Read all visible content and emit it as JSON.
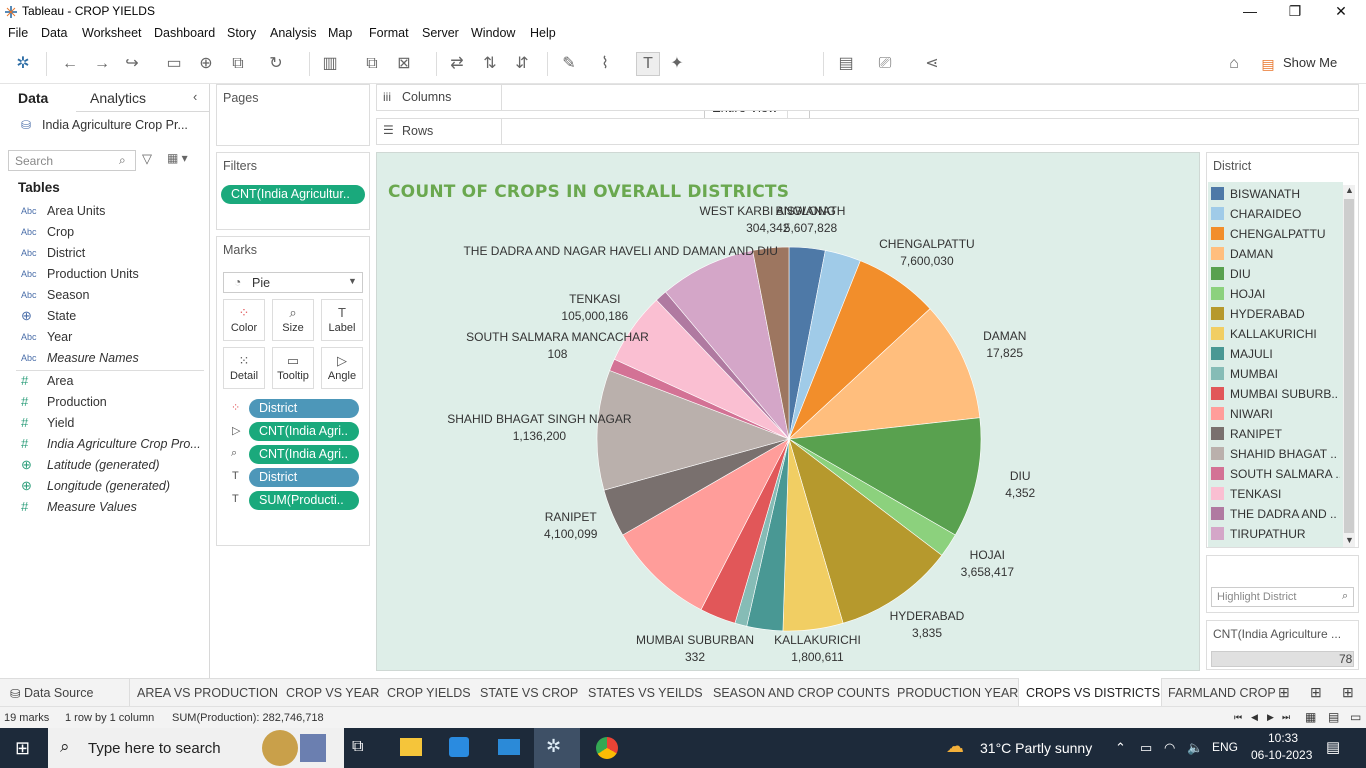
{
  "window": {
    "title": "Tableau - CROP YIELDS",
    "minimize": "—",
    "restore": "❐",
    "close": "✕"
  },
  "menu": [
    "File",
    "Data",
    "Worksheet",
    "Dashboard",
    "Story",
    "Analysis",
    "Map",
    "Format",
    "Server",
    "Window",
    "Help"
  ],
  "toolbar": {
    "fit_mode": "Entire View",
    "show_me": "Show Me"
  },
  "data_pane": {
    "tab_data": "Data",
    "tab_analytics": "Analytics",
    "datasource": "India Agriculture Crop Pr...",
    "search_placeholder": "Search",
    "tables_heading": "Tables",
    "dimensions": [
      {
        "type": "Abc",
        "name": "Area Units"
      },
      {
        "type": "Abc",
        "name": "Crop"
      },
      {
        "type": "Abc",
        "name": "District"
      },
      {
        "type": "Abc",
        "name": "Production Units"
      },
      {
        "type": "Abc",
        "name": "Season"
      },
      {
        "type": "⊕",
        "name": "State"
      },
      {
        "type": "Abc",
        "name": "Year"
      },
      {
        "type": "Abc",
        "name": "Measure Names"
      }
    ],
    "measures": [
      {
        "type": "#",
        "name": "Area"
      },
      {
        "type": "#",
        "name": "Production"
      },
      {
        "type": "#",
        "name": "Yield"
      },
      {
        "type": "#",
        "name": "India Agriculture Crop Pro..."
      },
      {
        "type": "⊕",
        "name": "Latitude (generated)"
      },
      {
        "type": "⊕",
        "name": "Longitude (generated)"
      },
      {
        "type": "#",
        "name": "Measure Values"
      }
    ]
  },
  "pages": {
    "title": "Pages"
  },
  "filters": {
    "title": "Filters",
    "pill": "CNT(India Agricultur.."
  },
  "marks": {
    "title": "Marks",
    "type": "Pie",
    "buttons": [
      "Color",
      "Size",
      "Label",
      "Detail",
      "Tooltip",
      "Angle"
    ],
    "pills": [
      "District",
      "CNT(India Agri..",
      "CNT(India Agri..",
      "District",
      "SUM(Producti.."
    ]
  },
  "shelves": {
    "columns": "Columns",
    "rows": "Rows"
  },
  "chart": {
    "title": "COUNT OF CROPS IN OVERALL DISTRICTS"
  },
  "chart_data": {
    "type": "pie",
    "slices": [
      {
        "name": "BISWANATH",
        "count": 3,
        "production": "5,607,828",
        "color": "#4e79a7"
      },
      {
        "name": "CHARAIDEO",
        "count": 3,
        "production": "",
        "color": "#a0cbe8"
      },
      {
        "name": "CHENGALPATTU",
        "count": 7,
        "production": "7,600,030",
        "color": "#f28e2b"
      },
      {
        "name": "DAMAN",
        "count": 10,
        "production": "17,825",
        "color": "#ffbe7d"
      },
      {
        "name": "DIU",
        "count": 10,
        "production": "4,352",
        "color": "#59a14f"
      },
      {
        "name": "HOJAI",
        "count": 2,
        "production": "3,658,417",
        "color": "#8cd17d"
      },
      {
        "name": "HYDERABAD",
        "count": 10,
        "production": "3,835",
        "color": "#b6992d"
      },
      {
        "name": "KALLAKURICHI",
        "count": 5,
        "production": "1,800,611",
        "color": "#f1ce63"
      },
      {
        "name": "MAJULI",
        "count": 3,
        "production": "",
        "color": "#499894"
      },
      {
        "name": "MUMBAI",
        "count": 1,
        "production": "",
        "color": "#86bcb6"
      },
      {
        "name": "MUMBAI SUBURBAN",
        "count": 3,
        "production": "332",
        "color": "#e15759"
      },
      {
        "name": "NIWARI",
        "count": 9,
        "production": "",
        "color": "#ff9d9a"
      },
      {
        "name": "RANIPET",
        "count": 4,
        "production": "4,100,099",
        "color": "#79706e"
      },
      {
        "name": "SHAHID BHAGAT SINGH NAGAR",
        "count": 10,
        "production": "1,136,200",
        "color": "#bab0ac"
      },
      {
        "name": "SOUTH SALMARA MANCACHAR",
        "count": 1,
        "production": "108",
        "color": "#d37295"
      },
      {
        "name": "TENKASI",
        "count": 6,
        "production": "105,000,186",
        "color": "#fabfd2"
      },
      {
        "name": "THE DADRA AND NAGAR HAVELI AND DAMAN AND DIU",
        "count": 1,
        "production": "",
        "color": "#b07aa1"
      },
      {
        "name": "TIRUPATHUR",
        "count": 8,
        "production": "",
        "color": "#d4a6c8"
      },
      {
        "name": "WEST KARBI ANGLONG",
        "count": 3,
        "production": "304,342",
        "color": "#9d7660"
      }
    ]
  },
  "legend": {
    "title": "District",
    "items": [
      {
        "name": "BISWANATH",
        "color": "#4e79a7"
      },
      {
        "name": "CHARAIDEO",
        "color": "#a0cbe8"
      },
      {
        "name": "CHENGALPATTU",
        "color": "#f28e2b"
      },
      {
        "name": "DAMAN",
        "color": "#ffbe7d"
      },
      {
        "name": "DIU",
        "color": "#59a14f"
      },
      {
        "name": "HOJAI",
        "color": "#8cd17d"
      },
      {
        "name": "HYDERABAD",
        "color": "#b6992d"
      },
      {
        "name": "KALLAKURICHI",
        "color": "#f1ce63"
      },
      {
        "name": "MAJULI",
        "color": "#499894"
      },
      {
        "name": "MUMBAI",
        "color": "#86bcb6"
      },
      {
        "name": "MUMBAI SUBURB..",
        "color": "#e15759"
      },
      {
        "name": "NIWARI",
        "color": "#ff9d9a"
      },
      {
        "name": "RANIPET",
        "color": "#79706e"
      },
      {
        "name": "SHAHID BHAGAT ..",
        "color": "#bab0ac"
      },
      {
        "name": "SOUTH SALMARA ..",
        "color": "#d37295"
      },
      {
        "name": "TENKASI",
        "color": "#fabfd2"
      },
      {
        "name": "THE DADRA AND ..",
        "color": "#b07aa1"
      },
      {
        "name": "TIRUPATHUR",
        "color": "#d4a6c8"
      }
    ],
    "highlight_placeholder": "Highlight District",
    "cnt_title": "CNT(India Agriculture ...",
    "cnt_value": "78"
  },
  "sheet_tabs": {
    "data_source": "Data Source",
    "tabs": [
      "AREA VS PRODUCTION",
      "CROP VS YEAR",
      "CROP YIELDS",
      "STATE VS CROP",
      "STATES VS YEILDS",
      "SEASON AND CROP COUNTS",
      "PRODUCTION YEAR",
      "CROPS VS DISTRICTS",
      "FARMLAND CROP"
    ],
    "active": "CROPS VS DISTRICTS"
  },
  "status": {
    "marks": "19 marks",
    "dims": "1 row by 1 column",
    "sum": "SUM(Production): 282,746,718"
  },
  "taskbar": {
    "search_placeholder": "Type here to search",
    "weather": "31°C  Partly sunny",
    "lang": "ENG",
    "time": "10:33",
    "date": "06-10-2023"
  }
}
